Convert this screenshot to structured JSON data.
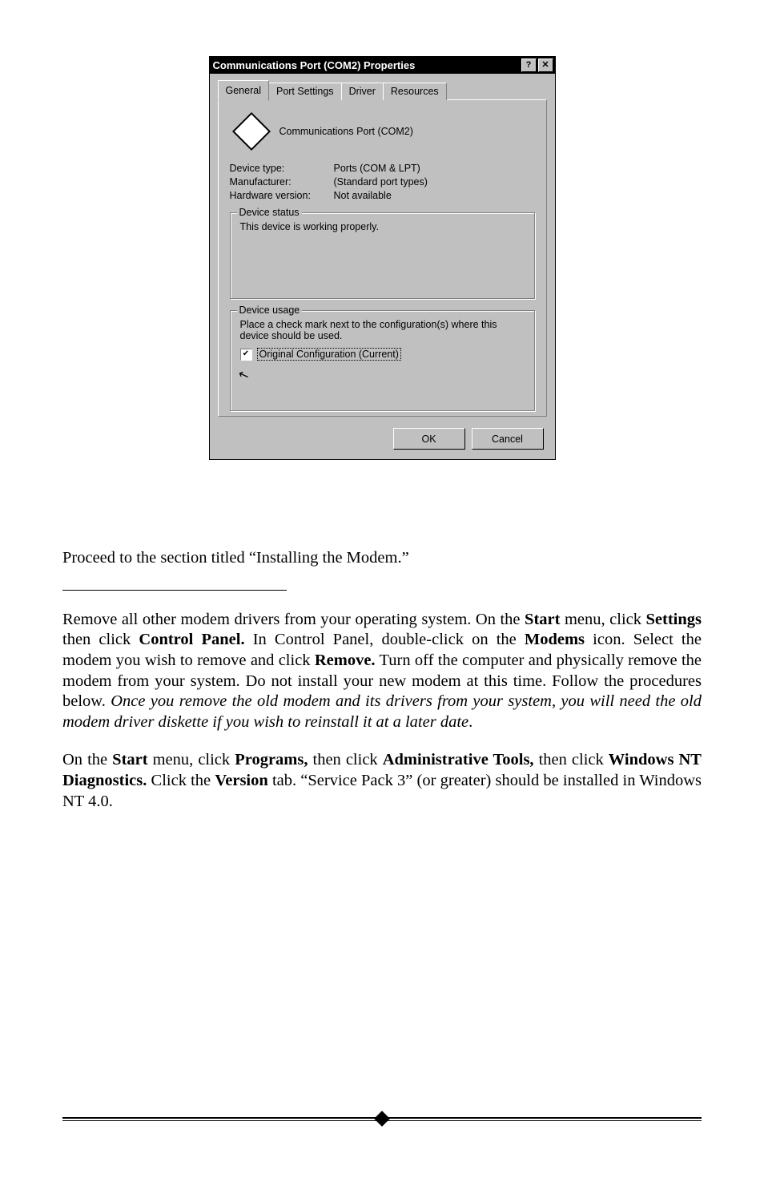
{
  "dialog": {
    "title": "Communications Port (COM2) Properties",
    "help_glyph": "?",
    "close_glyph": "✕",
    "tabs": {
      "general": "General",
      "port_settings": "Port Settings",
      "driver": "Driver",
      "resources": "Resources"
    },
    "icon_label": "Communications Port (COM2)",
    "rows": {
      "device_type_label": "Device type:",
      "device_type_value": "Ports (COM & LPT)",
      "manufacturer_label": "Manufacturer:",
      "manufacturer_value": "(Standard port types)",
      "hw_version_label": "Hardware version:",
      "hw_version_value": "Not available"
    },
    "status_legend": "Device status",
    "status_text": "This device is working properly.",
    "usage_legend": "Device usage",
    "usage_text": "Place a check mark next to the configuration(s) where this device should be used.",
    "config_label": "Original Configuration  (Current)",
    "ok": "OK",
    "cancel": "Cancel"
  },
  "doc": {
    "p1": "Proceed to the section titled “Installing the Modem.”",
    "p2_a": "Remove all other modem drivers from your operating system. On the ",
    "p2_b": "Start",
    "p2_c": " menu, click ",
    "p2_d": "Settings",
    "p2_e": " then click ",
    "p2_f": "Control Panel.",
    "p2_g": " In Control Panel, double-click on the ",
    "p2_h": "Mo­dems",
    "p2_i": " icon. Select the modem you wish to remove and click ",
    "p2_j": "Remove.",
    "p2_k": " Turn off the computer and physically remove the modem from your system. Do not install your new modem at this time. Follow the procedures below. ",
    "p2_l": "Once you remove the old mo­dem and its drivers from your system, you will need the old modem driver diskette if you wish to reinstall it at a later date",
    "p2_m": ".",
    "p3_a": "On the ",
    "p3_b": "Start",
    "p3_c": " menu, click ",
    "p3_d": "Programs,",
    "p3_e": " then click ",
    "p3_f": "Administrative Tools,",
    "p3_g": " then click ",
    "p3_h": "Windows NT Diagnostics.",
    "p3_i": " Click the ",
    "p3_j": "Version",
    "p3_k": " tab. “Service Pack 3” (or greater) should be installed in Windows NT 4.0."
  }
}
